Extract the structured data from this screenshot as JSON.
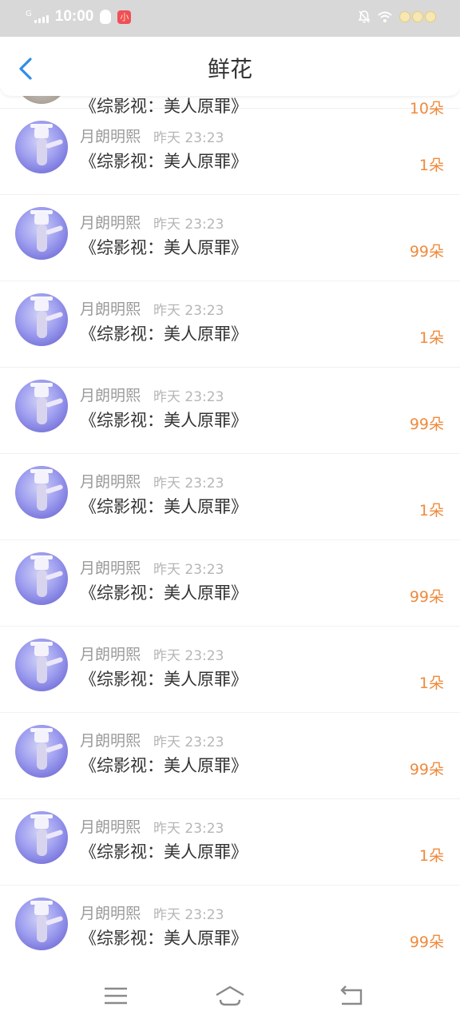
{
  "status_bar": {
    "network_label": "G",
    "time": "10:00",
    "app_badge": "小"
  },
  "header": {
    "title": "鲜花"
  },
  "items": [
    {
      "book": "《综影视：美人原罪》",
      "count": "10朵"
    },
    {
      "username": "月朗明熙",
      "time": "昨天 23:23",
      "book": "《综影视：美人原罪》",
      "count": "1朵"
    },
    {
      "username": "月朗明熙",
      "time": "昨天 23:23",
      "book": "《综影视：美人原罪》",
      "count": "99朵"
    },
    {
      "username": "月朗明熙",
      "time": "昨天 23:23",
      "book": "《综影视：美人原罪》",
      "count": "1朵"
    },
    {
      "username": "月朗明熙",
      "time": "昨天 23:23",
      "book": "《综影视：美人原罪》",
      "count": "99朵"
    },
    {
      "username": "月朗明熙",
      "time": "昨天 23:23",
      "book": "《综影视：美人原罪》",
      "count": "1朵"
    },
    {
      "username": "月朗明熙",
      "time": "昨天 23:23",
      "book": "《综影视：美人原罪》",
      "count": "99朵"
    },
    {
      "username": "月朗明熙",
      "time": "昨天 23:23",
      "book": "《综影视：美人原罪》",
      "count": "1朵"
    },
    {
      "username": "月朗明熙",
      "time": "昨天 23:23",
      "book": "《综影视：美人原罪》",
      "count": "99朵"
    },
    {
      "username": "月朗明熙",
      "time": "昨天 23:23",
      "book": "《综影视：美人原罪》",
      "count": "1朵"
    },
    {
      "username": "月朗明熙",
      "time": "昨天 23:23",
      "book": "《综影视：美人原罪》",
      "count": "99朵"
    }
  ],
  "icons": {
    "back": "back-arrow-icon",
    "menu": "menu-icon",
    "home": "home-icon",
    "return": "return-icon"
  },
  "colors": {
    "accent": "#2f8ee6",
    "count": "#ef8a3c",
    "status_bar": "#d8d8d8"
  }
}
